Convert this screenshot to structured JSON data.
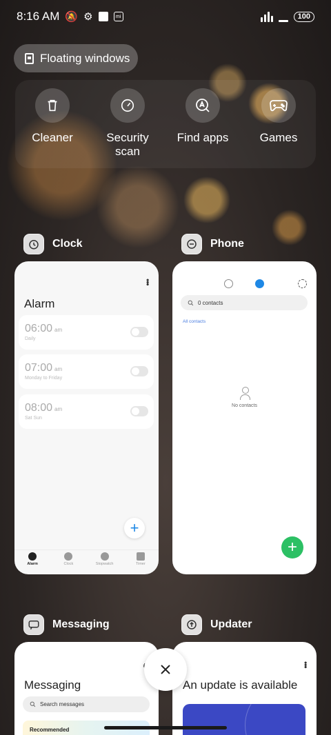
{
  "status_bar": {
    "time": "8:16 AM",
    "battery": "100"
  },
  "floating_windows": {
    "label": "Floating windows"
  },
  "tools": [
    {
      "label": "Cleaner",
      "icon": "trash-icon"
    },
    {
      "label": "Security scan",
      "icon": "speedometer-icon"
    },
    {
      "label": "Find apps",
      "icon": "find-apps-icon"
    },
    {
      "label": "Games",
      "icon": "gamepad-icon"
    }
  ],
  "apps": {
    "clock": {
      "name": "Clock",
      "title": "Alarm",
      "alarms": [
        {
          "time": "06:00",
          "ampm": "am",
          "repeat": "Daily",
          "enabled": false
        },
        {
          "time": "07:00",
          "ampm": "am",
          "repeat": "Monday to Friday",
          "enabled": false
        },
        {
          "time": "08:00",
          "ampm": "am",
          "repeat": "Sat Sun",
          "enabled": false
        }
      ],
      "add_label": "+",
      "nav": [
        "Alarm",
        "Clock",
        "Stopwatch",
        "Timer"
      ],
      "active_nav": "Alarm"
    },
    "phone": {
      "name": "Phone",
      "search_text": "0 contacts",
      "all_contacts": "All contacts",
      "empty_text": "No contacts",
      "add_label": "+",
      "accent": "#2cc064"
    },
    "messaging": {
      "name": "Messaging",
      "title": "Messaging",
      "search_placeholder": "Search messages",
      "recommended": "Recommended"
    },
    "updater": {
      "name": "Updater",
      "title": "An update is available",
      "banner_color": "#3b48c4"
    }
  },
  "close_label": "✕"
}
